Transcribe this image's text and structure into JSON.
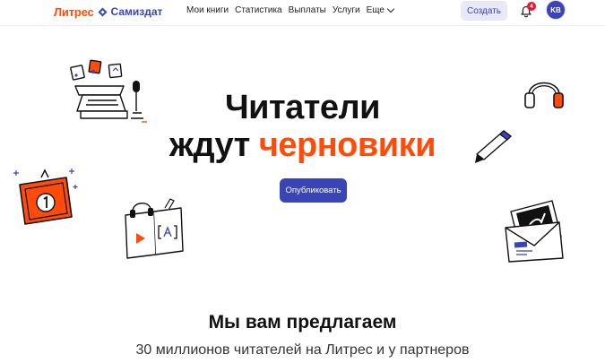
{
  "header": {
    "logo": {
      "brand": "Литрес",
      "product": "Самиздат"
    },
    "nav": [
      "Мои книги",
      "Статистика",
      "Выплаты",
      "Услуги"
    ],
    "more_label": "Еще",
    "create_label": "Создать",
    "notifications_count": "4",
    "avatar_initials": "KB"
  },
  "hero": {
    "line1": "Читатели",
    "line2_prefix": "ждут ",
    "line2_accent": "черновики",
    "publish_label": "Опубликовать"
  },
  "offer": {
    "title": "Мы вам предлагаем",
    "subtitle": "30 миллионов читателей на Литрес и у партнеров"
  },
  "colors": {
    "accent_orange": "#ff4c0a",
    "brand_blue": "#3b44b7",
    "badge_red": "#e8172f"
  },
  "illustrations": [
    "typewriter",
    "headphones",
    "medal-frame",
    "pen",
    "audiobook",
    "photo-envelope"
  ]
}
